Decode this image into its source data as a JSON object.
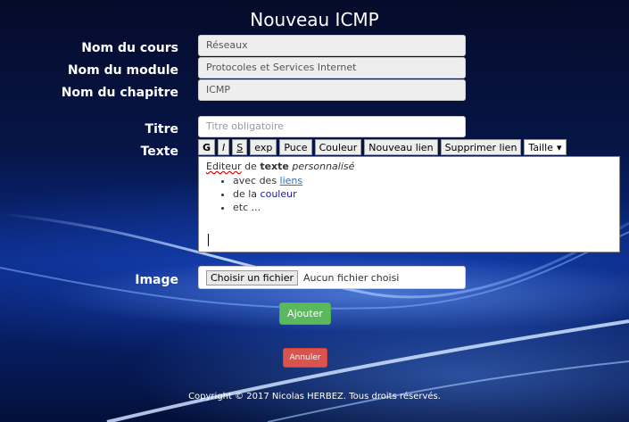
{
  "page": {
    "title": "Nouveau ICMP"
  },
  "form": {
    "course": {
      "label": "Nom du cours",
      "value": "Réseaux"
    },
    "module": {
      "label": "Nom du module",
      "value": "Protocoles et Services Internet"
    },
    "chapter": {
      "label": "Nom du chapitre",
      "value": "ICMP"
    },
    "title": {
      "label": "Titre",
      "placeholder": "Titre obligatoire"
    },
    "text": {
      "label": "Texte"
    },
    "image": {
      "label": "Image",
      "button": "Choisir un fichier",
      "status": "Aucun fichier choisi"
    }
  },
  "toolbar": {
    "bold": "G",
    "italic": "I",
    "strike": "S",
    "exp": "exp",
    "bullet": "Puce",
    "color": "Couleur",
    "new_link": "Nouveau lien",
    "remove_link": "Supprimer lien",
    "size": "Taille",
    "size_arrow": "▾"
  },
  "editor": {
    "line1_a": "Editeur",
    "line1_b": " de ",
    "line1_c": "texte",
    "line1_d": " personnalisé",
    "item1_a": "avec des ",
    "item1_b": "liens",
    "item2_a": "de la ",
    "item2_b": "couleur",
    "item3": "etc ..."
  },
  "actions": {
    "submit": "Ajouter",
    "cancel": "Annuler"
  },
  "footer": {
    "text": "Copyright © 2017 Nicolas HERBEZ. Tous droits réservés."
  }
}
